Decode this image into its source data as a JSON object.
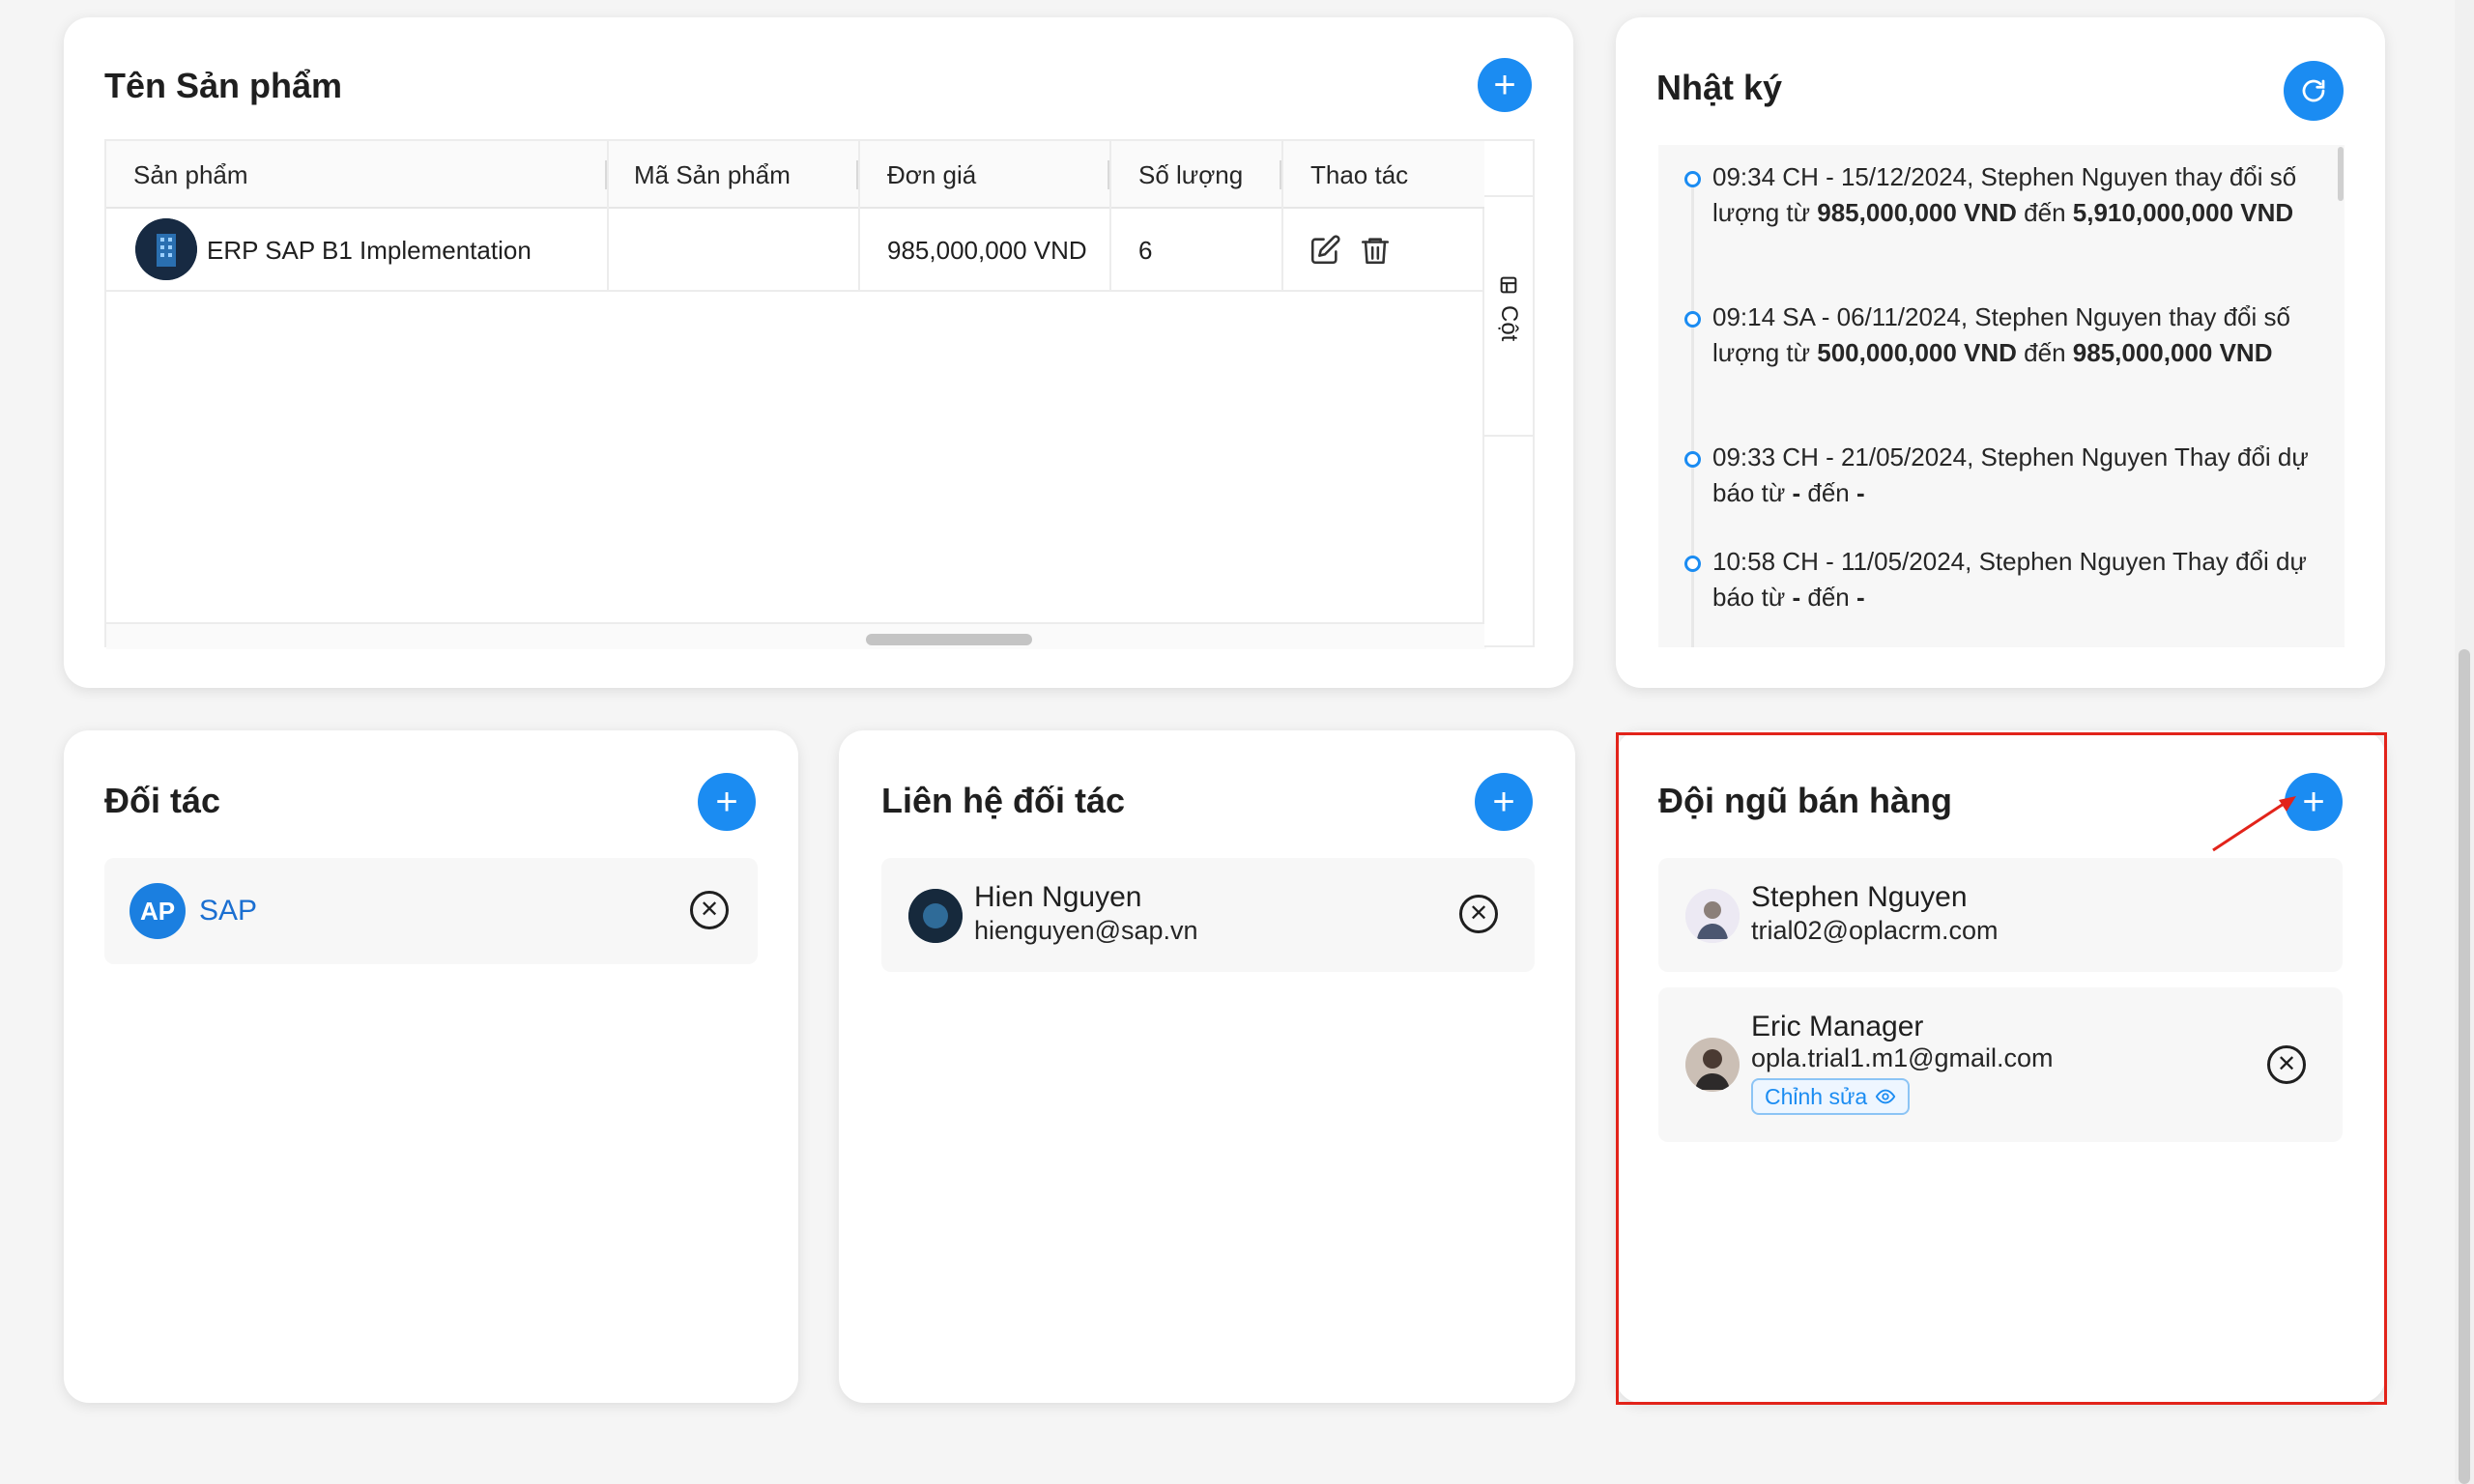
{
  "products_card": {
    "title": "Tên Sản phẩm",
    "add_icon": "plus-icon",
    "columns": [
      "Sản phẩm",
      "Mã Sản phẩm",
      "Đơn giá",
      "Số lượng",
      "Thao tác"
    ],
    "rows": [
      {
        "product": "ERP SAP B1 Implementation",
        "code": "",
        "price": "985,000,000 VND",
        "quantity": "6",
        "actions": [
          "edit-icon",
          "trash-icon"
        ]
      }
    ],
    "column_toggle_label": "Cột"
  },
  "log_card": {
    "title": "Nhật ký",
    "refresh_icon": "refresh-icon",
    "entries": [
      {
        "prefix": "09:34 CH - 15/12/2024, Stephen Nguyen thay đổi số lượng từ ",
        "from": "985,000,000 VND",
        "mid": " đến ",
        "to": "5,910,000,000 VND"
      },
      {
        "prefix": "09:14 SA - 06/11/2024, Stephen Nguyen thay đổi số lượng từ ",
        "from": "500,000,000 VND",
        "mid": " đến ",
        "to": "985,000,000 VND"
      },
      {
        "prefix": "09:33 CH - 21/05/2024, Stephen Nguyen Thay đổi dự báo từ ",
        "from": "-",
        "mid": " đến ",
        "to": "-"
      },
      {
        "prefix": "10:58 CH - 11/05/2024, Stephen Nguyen Thay đổi dự báo từ ",
        "from": "-",
        "mid": " đến ",
        "to": "-"
      }
    ]
  },
  "partners_card": {
    "title": "Đối tác",
    "items": [
      {
        "name": "SAP",
        "logo_text": "AP"
      }
    ]
  },
  "partner_contacts_card": {
    "title": "Liên hệ đối tác",
    "items": [
      {
        "name": "Hien Nguyen",
        "email": "hienguyen@sap.vn"
      }
    ]
  },
  "sales_team_card": {
    "title": "Đội ngũ bán hàng",
    "members": [
      {
        "name": "Stephen Nguyen",
        "email": "trial02@oplacrm.com"
      },
      {
        "name": "Eric Manager",
        "email": "opla.trial1.m1@gmail.com",
        "badge": "Chỉnh sửa"
      }
    ]
  },
  "colors": {
    "accent": "#1b8cf2",
    "highlight": "#e2231a",
    "link": "#1b6fd1"
  }
}
